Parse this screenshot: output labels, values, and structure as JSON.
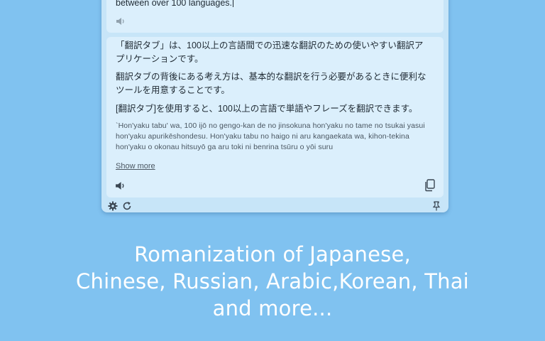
{
  "source": {
    "text_visible": "between over 100 languages."
  },
  "result": {
    "paragraphs": [
      "「翻訳タブ」は、100以上の言語間での迅速な翻訳のための使いやすい翻訳アプリケーションです。",
      "翻訳タブの背後にある考え方は、基本的な翻訳を行う必要があるときに便利なツールを用意することです。",
      "[翻訳タブ]を使用すると、100以上の言語で単語やフレーズを翻訳できます。"
    ],
    "romanization": "`Hon'yaku tabu' wa, 100 ijō no gengo-kan de no jinsokuna hon'yaku no tame no tsukai yasui hon'yaku apurikēshondesu. Hon'yaku tabu no haigo ni aru kangaekata wa, kihon-tekina hon'yaku o okonau hitsuyō ga aru toki ni benrina tsūru o yōi suru",
    "show_more_label": "Show more"
  },
  "icons": {
    "source_speaker": "speaker-icon",
    "result_speaker": "speaker-icon",
    "copy": "copy-icon",
    "settings": "gear-icon",
    "refresh": "refresh-icon",
    "pin": "pin-icon"
  },
  "caption": {
    "lines": [
      "Romanization of Japanese,",
      "Chinese, Russian, Arabic,Korean, Thai",
      "and more..."
    ]
  },
  "colors": {
    "background": "#80c2f0",
    "window": "#c7e5f8",
    "panel": "#dbeffc",
    "text": "#1f2a33",
    "muted_text": "#4a5661",
    "caption": "#ffffff"
  }
}
